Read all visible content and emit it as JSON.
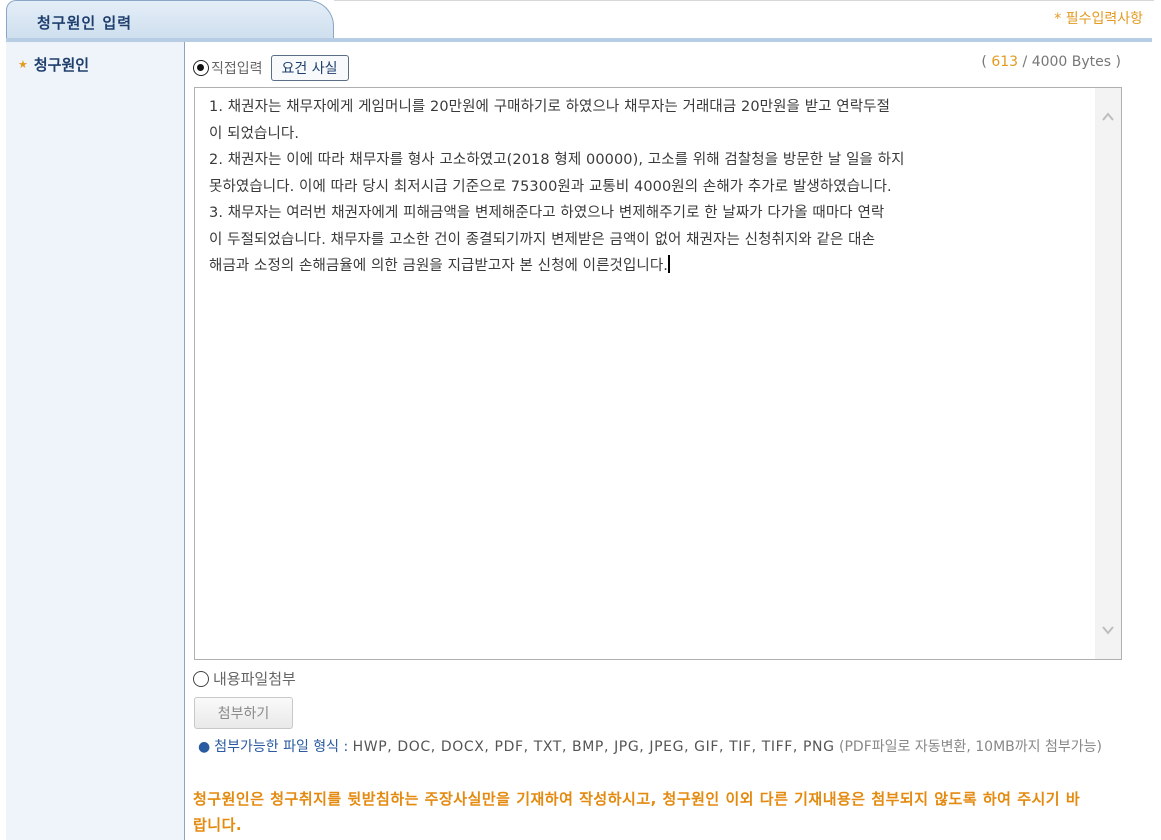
{
  "header": {
    "tab_title": "청구원인 입력",
    "required_note": "* 필수입력사항"
  },
  "sidebar": {
    "label": "청구원인",
    "star": "*"
  },
  "input_mode": {
    "direct_label": "직접입력",
    "facts_button": "요건 사실",
    "byte_count": "613",
    "byte_limit": "4000 Bytes",
    "byte_open": "(",
    "byte_sep": " / ",
    "byte_close": " )"
  },
  "claim_text": "1. 채권자는 채무자에게 게임머니를 20만원에 구매하기로 하였으나 채무자는 거래대금 20만원을 받고 연락두절\n이 되었습니다.\n2. 채권자는 이에 따라 채무자를 형사 고소하였고(2018 형제 00000), 고소를 위해 검찰청을 방문한 날 일을 하지\n못하였습니다. 이에 따라 당시 최저시급 기준으로 75300원과 교통비 4000원의 손해가 추가로 발생하였습니다.\n3. 채무자는 여러번 채권자에게 피해금액을 변제해준다고 하였으나 변제해주기로 한 날짜가 다가올 때마다 연락\n이 두절되었습니다. 채무자를 고소한 건이 종결되기까지 변제받은 금액이 없어 채권자는 신청취지와 같은 대손\n해금과 소정의 손해금율에 의한 금원을 지급받고자 본 신청에 이른것입니다.",
  "attach": {
    "radio_label": "내용파일첨부",
    "button": "첨부하기",
    "formats_label": "첨부가능한 파일 형식 :",
    "formats_list": "HWP, DOC, DOCX, PDF, TXT, BMP, JPG, JPEG, GIF, TIF, TIFF, PNG",
    "formats_note": "(PDF파일로 자동변환, 10MB까지 첨부가능)"
  },
  "notice": "청구원인은 청구취지를 뒷받침하는 주장사실만을 기재하여 작성하시고, 청구원인 이외 다른 기재내용은 첨부되지 않도록 하여 주시기 바랍니다.",
  "colors": {
    "accent_orange": "#e39a1f",
    "navy": "#1e3f6d",
    "sidebar_bg": "#eef4fa"
  }
}
